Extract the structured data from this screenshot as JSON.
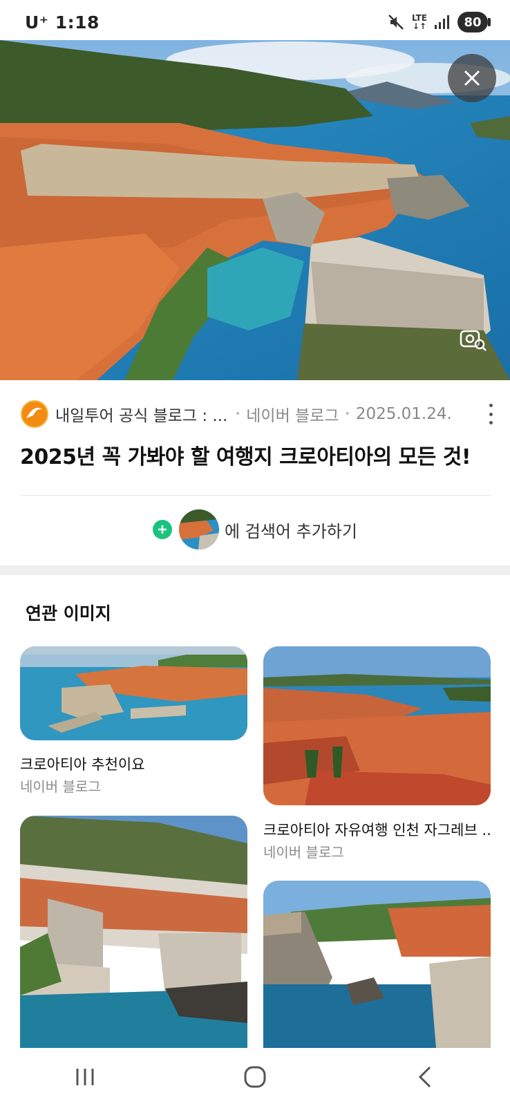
{
  "status_bar": {
    "carrier": "U⁺ 1:18",
    "network": "LTE",
    "battery": "80"
  },
  "hero": {
    "close_icon": "close-icon",
    "lens_icon": "image-search-icon"
  },
  "result": {
    "source_name": "내일투어 공식 블로그 : ...",
    "source_type": "네이버 블로그",
    "date": "2025.01.24.",
    "title": "2025년 꼭 가봐야 할 여행지 크로아티아의 모든 것!"
  },
  "add_search": {
    "label": "에 검색어 추가하기"
  },
  "related": {
    "heading": "연관 이미지",
    "items": [
      {
        "title": "크로아티아 추천이요",
        "source": "네이버 블로그"
      },
      {
        "title": "크로아티아 자유여행 인천 자그레브 ...",
        "source": "네이버 블로그"
      },
      {
        "title": "",
        "source": ""
      },
      {
        "title": "",
        "source": ""
      }
    ]
  },
  "nav": {
    "recents_icon": "recents-icon",
    "home_icon": "home-icon",
    "back_icon": "back-icon"
  },
  "colors": {
    "accent_green": "#19c37d",
    "sea": "#2a8fc4",
    "roof": "#d9622b"
  }
}
